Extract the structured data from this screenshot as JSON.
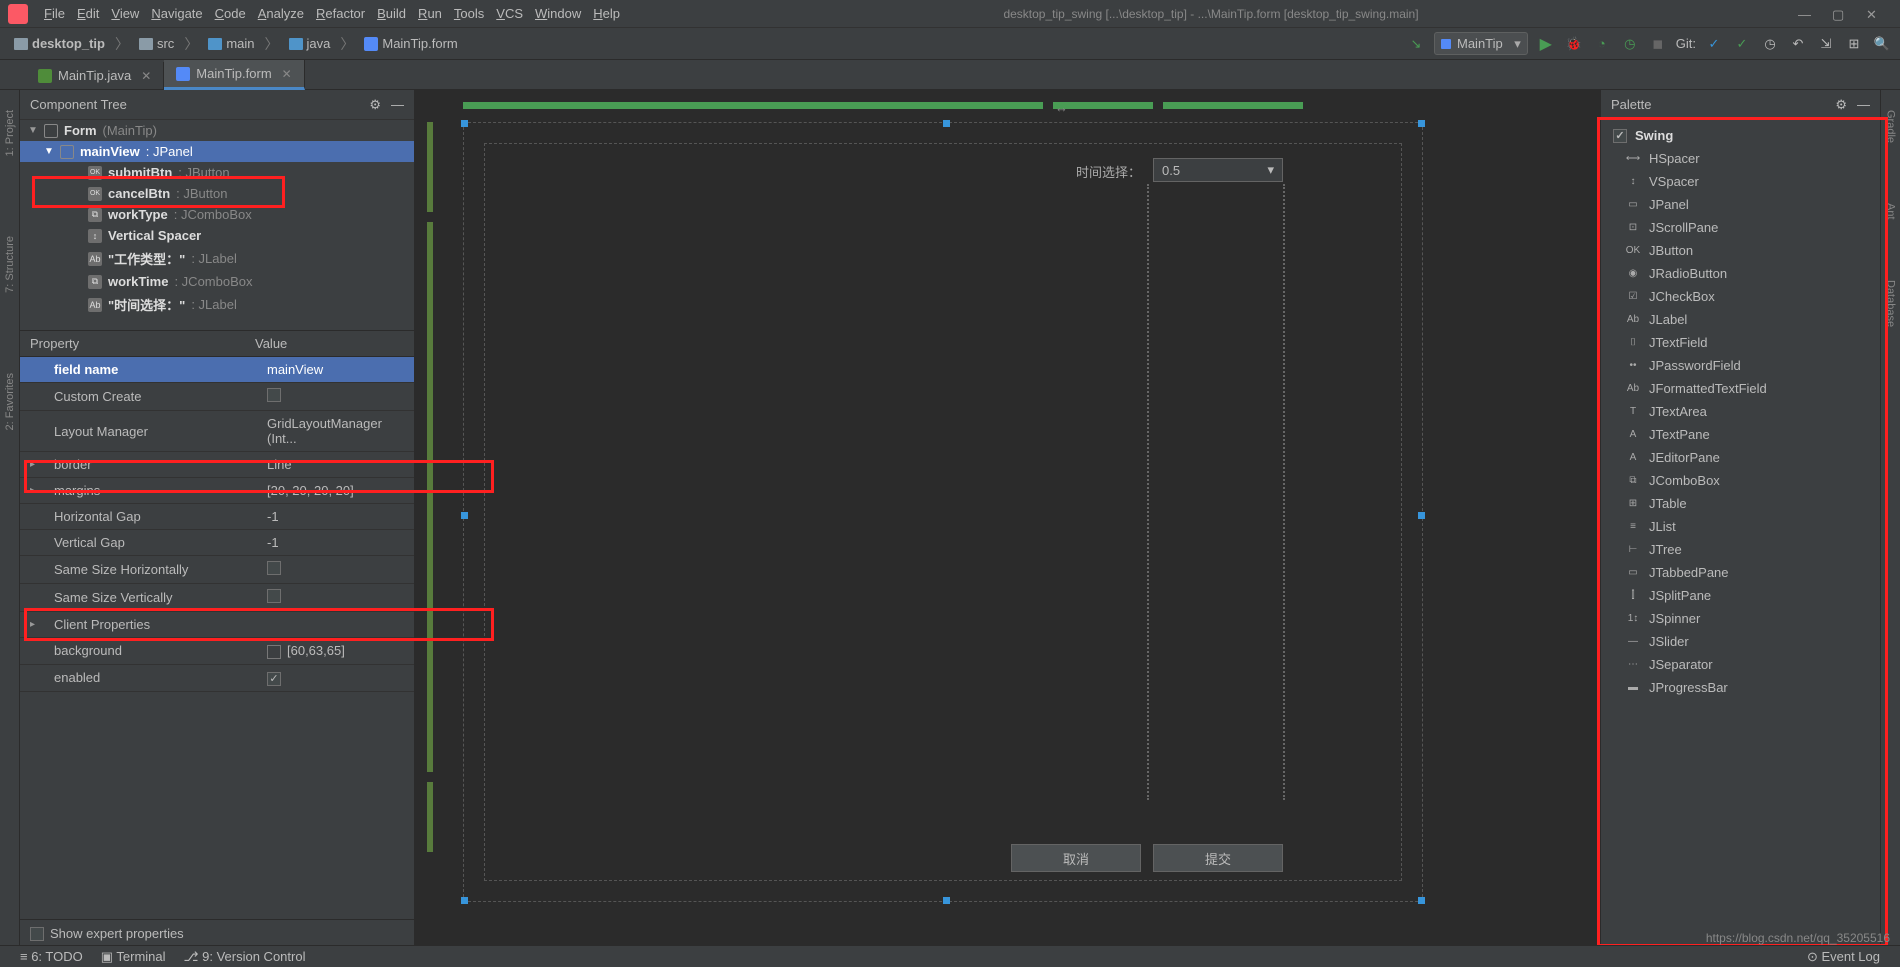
{
  "menu": [
    "File",
    "Edit",
    "View",
    "Navigate",
    "Code",
    "Analyze",
    "Refactor",
    "Build",
    "Run",
    "Tools",
    "VCS",
    "Window",
    "Help"
  ],
  "title": "desktop_tip_swing [...\\desktop_tip] - ...\\MainTip.form [desktop_tip_swing.main]",
  "breadcrumbs": [
    {
      "label": "desktop_tip",
      "icon": "folder"
    },
    {
      "label": "src",
      "icon": "folder"
    },
    {
      "label": "main",
      "icon": "folder-blue"
    },
    {
      "label": "java",
      "icon": "folder-blue"
    },
    {
      "label": "MainTip.form",
      "icon": "form"
    }
  ],
  "run_config": "MainTip",
  "git_label": "Git:",
  "tabs": [
    {
      "label": "MainTip.java",
      "icon": "java",
      "active": false
    },
    {
      "label": "MainTip.form",
      "icon": "form",
      "active": true
    }
  ],
  "tree_panel_title": "Component Tree",
  "tree": [
    {
      "indent": 0,
      "arrow": "▼",
      "icon": "panel",
      "name": "Form",
      "type": "(MainTip)",
      "sel": false
    },
    {
      "indent": 1,
      "arrow": "▼",
      "icon": "panel",
      "name": "mainView",
      "type": ": JPanel",
      "sel": true
    },
    {
      "indent": 2,
      "arrow": "",
      "icon": "ok",
      "name": "submitBtn",
      "type": ": JButton",
      "sel": false,
      "iconText": "OK"
    },
    {
      "indent": 2,
      "arrow": "",
      "icon": "ok",
      "name": "cancelBtn",
      "type": ": JButton",
      "sel": false,
      "iconText": "OK"
    },
    {
      "indent": 2,
      "arrow": "",
      "icon": "combo",
      "name": "workType",
      "type": ": JComboBox",
      "sel": false,
      "iconText": "⧉"
    },
    {
      "indent": 2,
      "arrow": "",
      "icon": "vspace",
      "name": "Vertical Spacer",
      "type": "",
      "sel": false,
      "iconText": "↕"
    },
    {
      "indent": 2,
      "arrow": "",
      "icon": "label",
      "name": "\"工作类型：\"",
      "type": ": JLabel",
      "sel": false,
      "iconText": "Ab"
    },
    {
      "indent": 2,
      "arrow": "",
      "icon": "combo",
      "name": "workTime",
      "type": ": JComboBox",
      "sel": false,
      "iconText": "⧉"
    },
    {
      "indent": 2,
      "arrow": "",
      "icon": "label",
      "name": "\"时间选择：\"",
      "type": ": JLabel",
      "sel": false,
      "iconText": "Ab"
    }
  ],
  "prop_header": {
    "prop": "Property",
    "val": "Value"
  },
  "properties": [
    {
      "arrow": "",
      "name": "field name",
      "value": "mainView",
      "sel": true,
      "type": "text"
    },
    {
      "arrow": "",
      "name": "Custom Create",
      "value": "",
      "sel": false,
      "type": "check"
    },
    {
      "arrow": "",
      "name": "Layout Manager",
      "value": "GridLayoutManager (Int...",
      "sel": false,
      "type": "text"
    },
    {
      "arrow": "▸",
      "name": "border",
      "value": "Line",
      "sel": false,
      "type": "text"
    },
    {
      "arrow": "▸",
      "name": "margins",
      "value": "[20, 20, 20, 20]",
      "sel": false,
      "type": "text"
    },
    {
      "arrow": "",
      "name": "Horizontal Gap",
      "value": "-1",
      "sel": false,
      "type": "text"
    },
    {
      "arrow": "",
      "name": "Vertical Gap",
      "value": "-1",
      "sel": false,
      "type": "text"
    },
    {
      "arrow": "",
      "name": "Same Size Horizontally",
      "value": "",
      "sel": false,
      "type": "check"
    },
    {
      "arrow": "",
      "name": "Same Size Vertically",
      "value": "",
      "sel": false,
      "type": "check"
    },
    {
      "arrow": "▸",
      "name": "Client Properties",
      "value": "",
      "sel": false,
      "type": "text"
    },
    {
      "arrow": "",
      "name": "background",
      "value": "[60,63,65]",
      "sel": false,
      "type": "color"
    },
    {
      "arrow": "",
      "name": "enabled",
      "value": "",
      "sel": false,
      "type": "check_on"
    }
  ],
  "show_expert": "Show expert properties",
  "form": {
    "time_label": "时间选择：",
    "combo_value": "0.5",
    "cancel": "取消",
    "submit": "提交"
  },
  "palette_title": "Palette",
  "palette_group": "Swing",
  "palette": [
    {
      "icon": "⟷",
      "label": "HSpacer"
    },
    {
      "icon": "↕",
      "label": "VSpacer"
    },
    {
      "icon": "▭",
      "label": "JPanel"
    },
    {
      "icon": "⊡",
      "label": "JScrollPane"
    },
    {
      "icon": "OK",
      "label": "JButton"
    },
    {
      "icon": "◉",
      "label": "JRadioButton"
    },
    {
      "icon": "☑",
      "label": "JCheckBox"
    },
    {
      "icon": "Ab",
      "label": "JLabel"
    },
    {
      "icon": "⌷",
      "label": "JTextField"
    },
    {
      "icon": "••",
      "label": "JPasswordField"
    },
    {
      "icon": "Ab",
      "label": "JFormattedTextField"
    },
    {
      "icon": "T",
      "label": "JTextArea"
    },
    {
      "icon": "A",
      "label": "JTextPane"
    },
    {
      "icon": "A",
      "label": "JEditorPane"
    },
    {
      "icon": "⧉",
      "label": "JComboBox"
    },
    {
      "icon": "⊞",
      "label": "JTable"
    },
    {
      "icon": "≡",
      "label": "JList"
    },
    {
      "icon": "⊢",
      "label": "JTree"
    },
    {
      "icon": "▭",
      "label": "JTabbedPane"
    },
    {
      "icon": "⫿",
      "label": "JSplitPane"
    },
    {
      "icon": "1↕",
      "label": "JSpinner"
    },
    {
      "icon": "—",
      "label": "JSlider"
    },
    {
      "icon": "⋯",
      "label": "JSeparator"
    },
    {
      "icon": "▬",
      "label": "JProgressBar"
    }
  ],
  "sidebars_left": [
    "1: Project",
    "7: Structure",
    "2: Favorites"
  ],
  "sidebars_right": [
    "Gradle",
    "Ant",
    "Database"
  ],
  "bottom": [
    "≡ 6: TODO",
    "▣ Terminal",
    "⎇ 9: Version Control"
  ],
  "bottom_right": "⊙ Event Log",
  "watermark": "https://blog.csdn.net/qq_35205516"
}
